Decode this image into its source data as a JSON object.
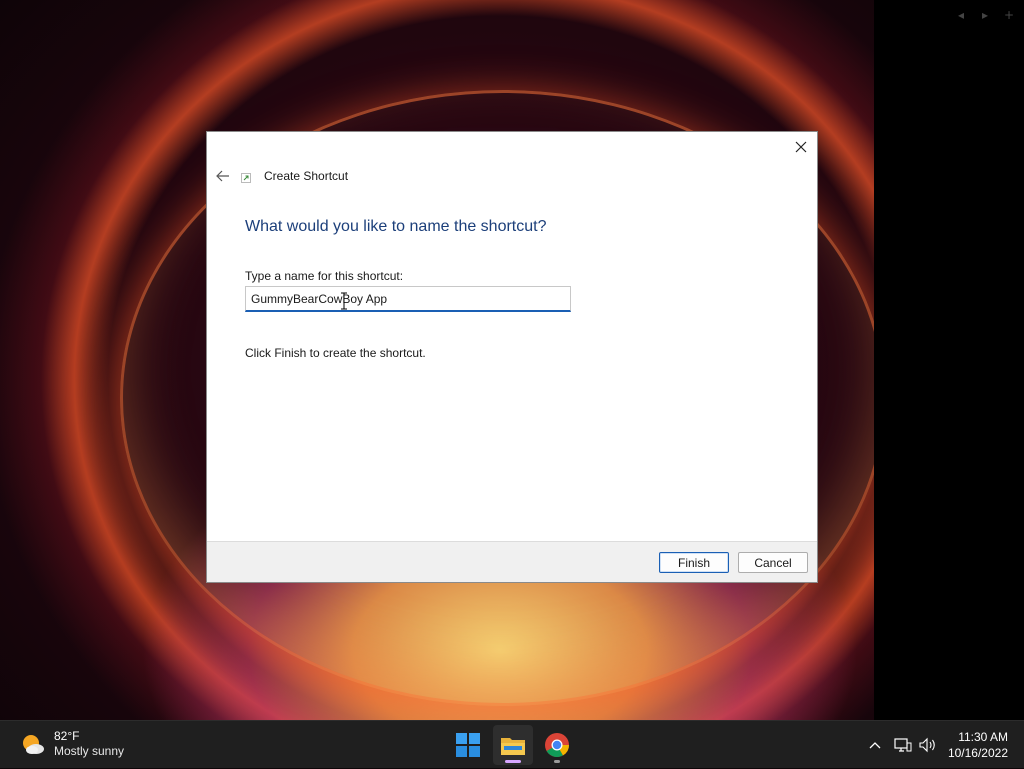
{
  "dialog": {
    "title": "Create Shortcut",
    "heading": "What would you like to name the shortcut?",
    "field_label": "Type a name for this shortcut:",
    "name_value": "GummyBearCowBoy App",
    "hint": "Click Finish to create the shortcut.",
    "finish_label": "Finish",
    "cancel_label": "Cancel"
  },
  "taskbar": {
    "weather_temp": "82°F",
    "weather_condition": "Mostly sunny",
    "time": "11:30 AM",
    "date": "10/16/2022",
    "apps": [
      "start-icon",
      "file-explorer-icon",
      "chrome-icon"
    ]
  },
  "colors": {
    "heading": "#1c3f7a",
    "input_focus": "#1a5fb4",
    "taskbar_bg": "#1f1f1f"
  }
}
